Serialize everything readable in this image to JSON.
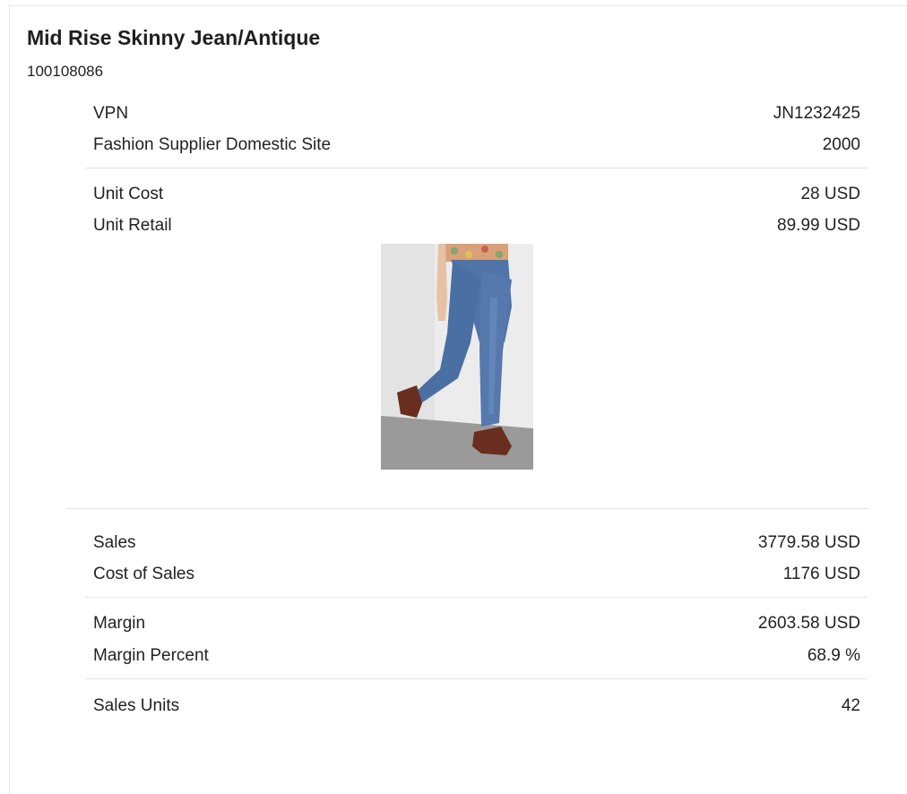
{
  "product": {
    "title": "Mid Rise Skinny Jean/Antique",
    "item_number": "100108086"
  },
  "details": {
    "vpn": {
      "label": "VPN",
      "value": "JN1232425"
    },
    "supplier_site": {
      "label": "Fashion Supplier Domestic Site",
      "value": "2000"
    },
    "unit_cost": {
      "label": "Unit Cost",
      "value": "28 USD"
    },
    "unit_retail": {
      "label": "Unit Retail",
      "value": "89.99 USD"
    }
  },
  "metrics": {
    "sales": {
      "label": "Sales",
      "value": "3779.58 USD"
    },
    "cost_of_sales": {
      "label": "Cost of Sales",
      "value": "1176 USD"
    },
    "margin": {
      "label": "Margin",
      "value": "2603.58 USD"
    },
    "margin_percent": {
      "label": "Margin Percent",
      "value": "68.9 %"
    },
    "sales_units": {
      "label": "Sales Units",
      "value": "42"
    }
  },
  "colors": {
    "divider": "#dfe5ea",
    "text": "#222222",
    "denim": "#4a6fa3"
  }
}
